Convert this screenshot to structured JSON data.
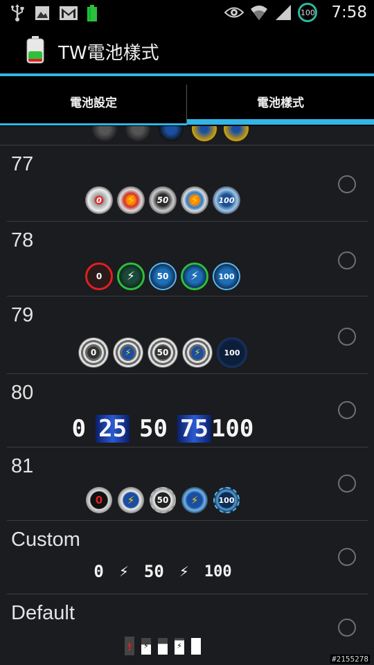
{
  "status_bar": {
    "battery_level": "100",
    "time": "7:58"
  },
  "action_bar": {
    "title": "TW電池樣式"
  },
  "tabs": [
    {
      "label": "電池設定",
      "selected": false
    },
    {
      "label": "電池樣式",
      "selected": true
    }
  ],
  "styles": [
    {
      "name": "77",
      "icon_labels": [
        "0",
        "",
        "50",
        "",
        "100"
      ]
    },
    {
      "name": "78",
      "icon_labels": [
        "0",
        "",
        "50",
        "",
        "100"
      ]
    },
    {
      "name": "79",
      "icon_labels": [
        "0",
        "",
        "50",
        "",
        "100"
      ]
    },
    {
      "name": "80",
      "icon_labels": [
        "0",
        "25",
        "50",
        "75",
        "100"
      ]
    },
    {
      "name": "81",
      "icon_labels": [
        "0",
        "",
        "50",
        "",
        "100"
      ]
    },
    {
      "name": "Custom",
      "icon_labels": [
        "0",
        "",
        "50",
        "",
        "100"
      ]
    },
    {
      "name": "Default",
      "icon_labels": [
        "!",
        "",
        "",
        "",
        ""
      ]
    }
  ],
  "watermark": "#2155278",
  "colors": {
    "accent": "#33b5e5",
    "charging_green": "#2fbf3a",
    "alert_red": "#e02020",
    "battery_teal": "#31b6a4"
  }
}
